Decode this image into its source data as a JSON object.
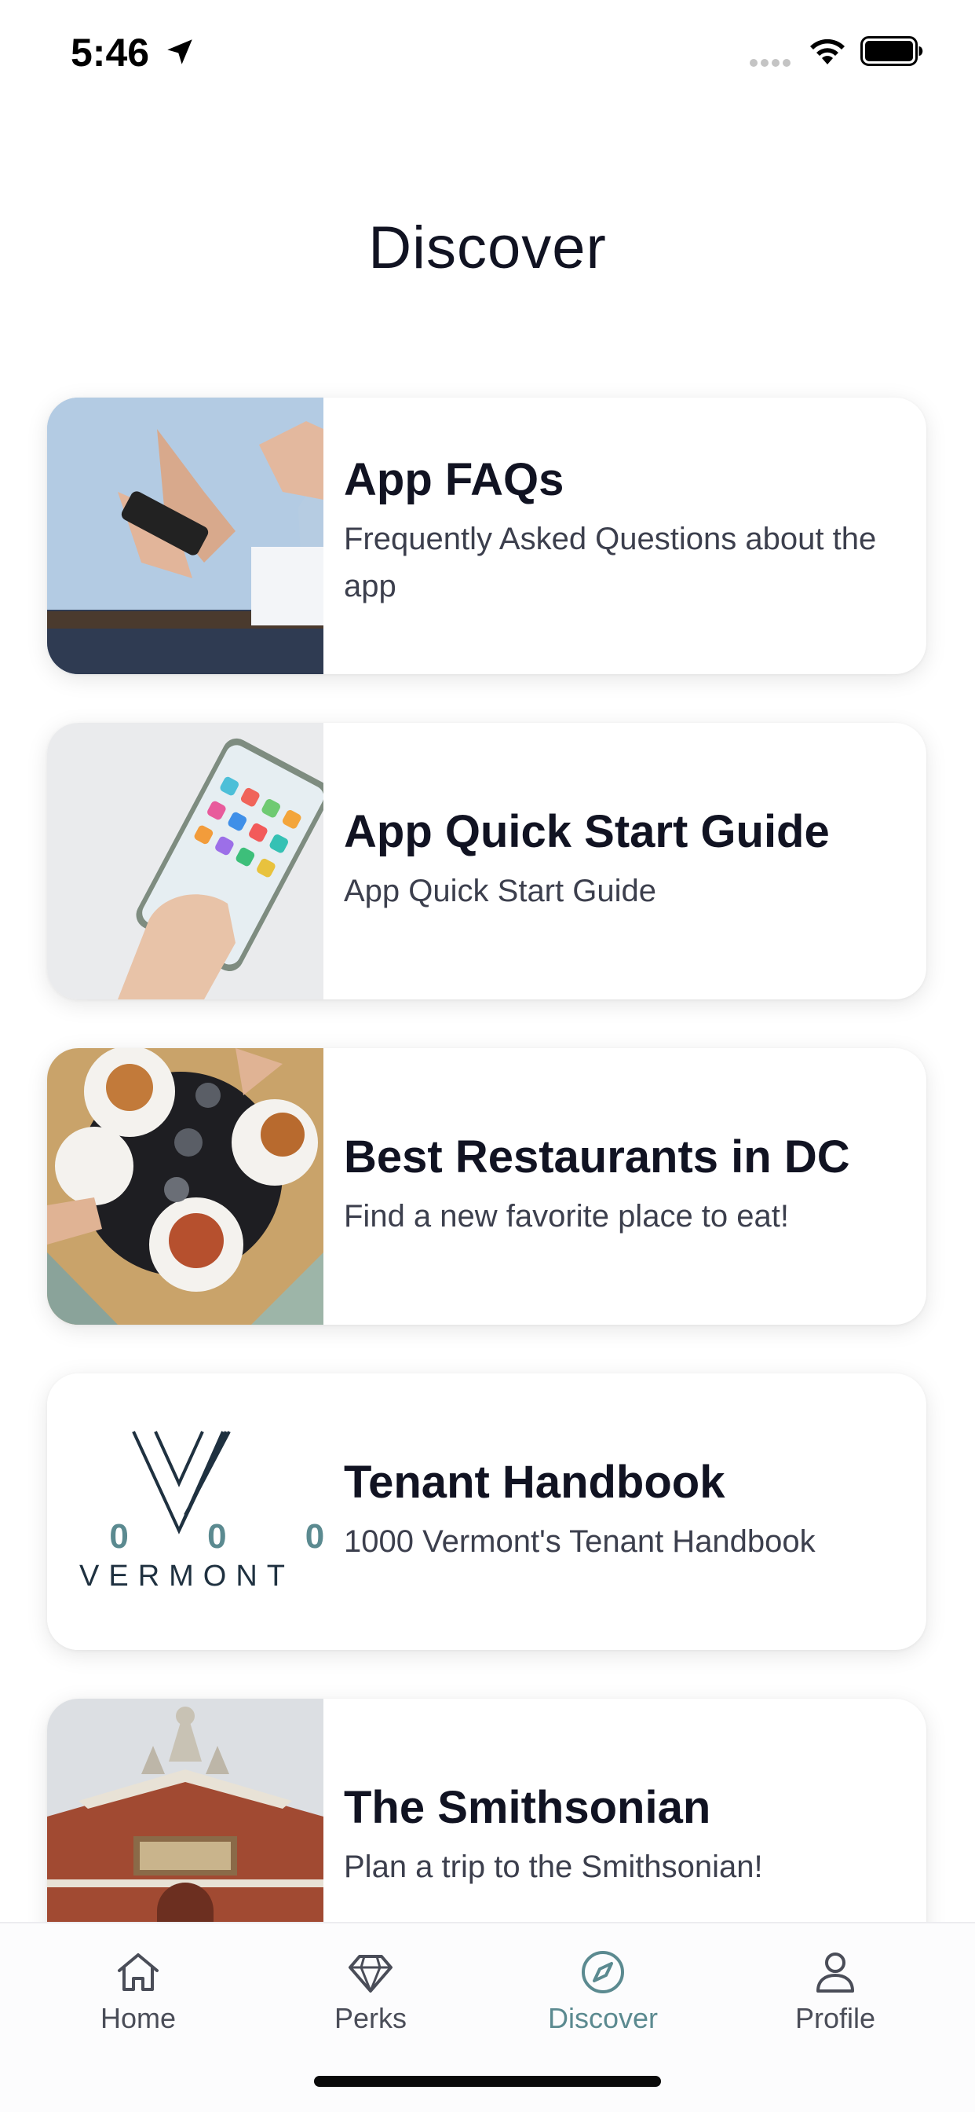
{
  "status_bar": {
    "time": "5:46"
  },
  "page": {
    "title": "Discover"
  },
  "cards": [
    {
      "title": "App FAQs",
      "description": "Frequently Asked Questions about the app"
    },
    {
      "title": "App Quick Start Guide",
      "description": "App Quick Start Guide"
    },
    {
      "title": "Best Restaurants in DC",
      "description": "Find a new favorite place to eat!"
    },
    {
      "title": "Tenant Handbook",
      "description": "1000 Vermont's Tenant Handbook",
      "logo_text": {
        "number": "1 0 0 0",
        "word": "VERMONT"
      }
    },
    {
      "title": "The Smithsonian",
      "description": "Plan a trip to the Smithsonian!"
    }
  ],
  "bottom_nav": [
    {
      "label": "Home",
      "icon": "home-icon",
      "active": false
    },
    {
      "label": "Perks",
      "icon": "diamond-icon",
      "active": false
    },
    {
      "label": "Discover",
      "icon": "compass-icon",
      "active": true
    },
    {
      "label": "Profile",
      "icon": "person-icon",
      "active": false
    }
  ],
  "colors": {
    "accent": "#5b8a90",
    "text": "#111322",
    "secondary_text": "#3c3f4d"
  }
}
